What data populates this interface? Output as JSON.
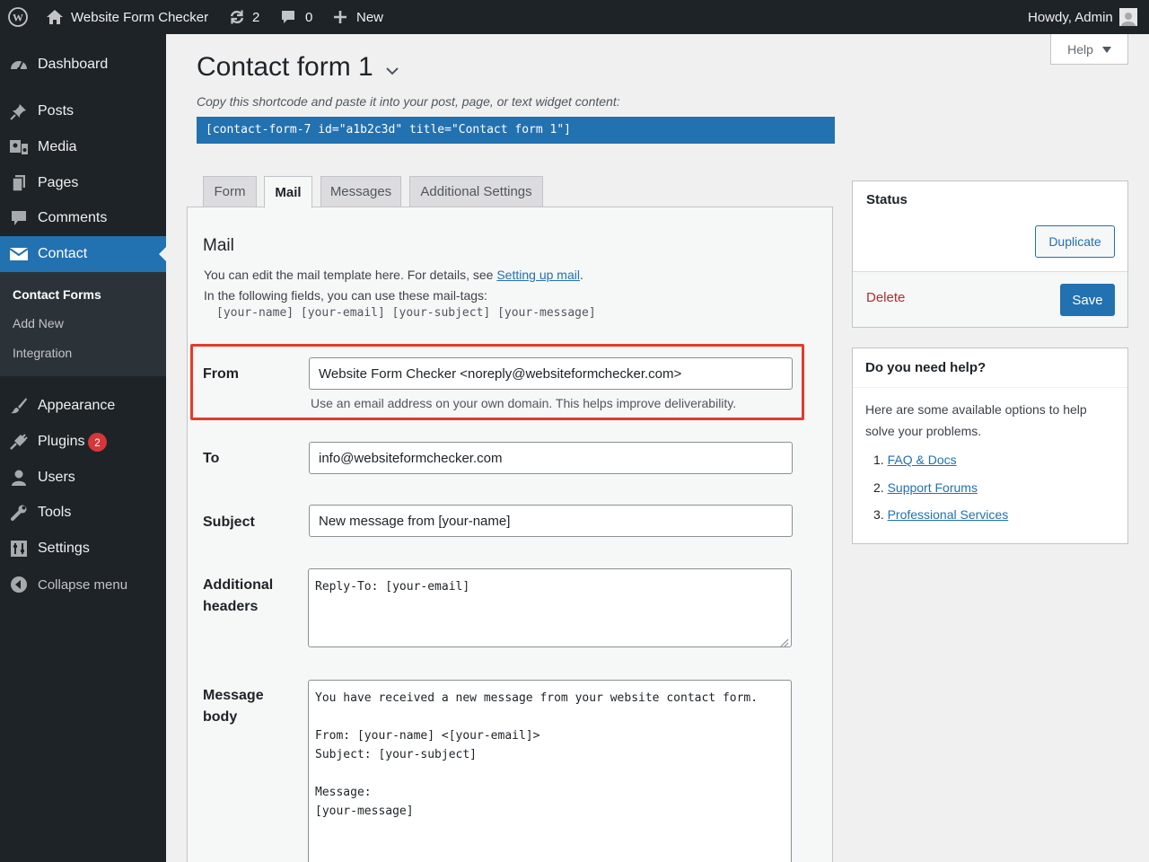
{
  "admin_bar": {
    "site_name": "Website Form Checker",
    "updates_count": "2",
    "comments_count": "0",
    "new_label": "New",
    "greeting": "Howdy, Admin"
  },
  "sidebar": {
    "items": [
      {
        "label": "Dashboard",
        "icon": "dashboard-icon"
      },
      {
        "label": "Posts",
        "icon": "pin-icon"
      },
      {
        "label": "Media",
        "icon": "media-icon"
      },
      {
        "label": "Pages",
        "icon": "pages-icon"
      },
      {
        "label": "Comments",
        "icon": "comment-icon"
      },
      {
        "label": "Contact",
        "icon": "envelope-icon"
      },
      {
        "label": "Appearance",
        "icon": "brush-icon"
      },
      {
        "label": "Plugins",
        "icon": "plug-icon",
        "badge": "2"
      },
      {
        "label": "Users",
        "icon": "user-icon"
      },
      {
        "label": "Tools",
        "icon": "wrench-icon"
      },
      {
        "label": "Settings",
        "icon": "settings-icon"
      },
      {
        "label": "Collapse menu",
        "icon": "collapse-icon"
      }
    ],
    "submenu": [
      "Contact Forms",
      "Add New",
      "Integration"
    ]
  },
  "help_tab": {
    "label": "Help"
  },
  "page": {
    "title": "Contact form 1",
    "shortcode_hint": "Copy this shortcode and paste it into your post, page, or text widget content:",
    "shortcode": "[contact-form-7 id=\"a1b2c3d\" title=\"Contact form 1\"]"
  },
  "tabs": [
    "Form",
    "Mail",
    "Messages",
    "Additional Settings"
  ],
  "mail": {
    "heading": "Mail",
    "desc_prefix": "You can edit the mail template here. For details, see ",
    "desc_link": "Setting up mail",
    "desc_suffix": ".",
    "tags_intro": "In the following fields, you can use these mail-tags:",
    "tags": "[your-name] [your-email] [your-subject] [your-message]",
    "fields": {
      "from": {
        "label": "From",
        "value": "Website Form Checker <noreply@websiteformchecker.com>",
        "help": "Use an email address on your own domain. This helps improve deliverability."
      },
      "to": {
        "label": "To",
        "value": "info@websiteformchecker.com"
      },
      "subject": {
        "label": "Subject",
        "value": "New message from [your-name]"
      },
      "additional_headers": {
        "label_line1": "Additional",
        "label_line2": "headers",
        "value": "Reply-To: [your-email]"
      },
      "message_body": {
        "label_line1": "Message",
        "label_line2": "body",
        "value": "You have received a new message from your website contact form.\n\nFrom: [your-name] <[your-email]>\nSubject: [your-subject]\n\nMessage:\n[your-message]"
      }
    }
  },
  "status_box": {
    "title": "Status",
    "duplicate_label": "Duplicate",
    "delete_label": "Delete",
    "save_label": "Save"
  },
  "help_box": {
    "title": "Do you need help?",
    "text_line1": "Here are some available options to help",
    "text_line2": "solve your problems.",
    "links": [
      {
        "num": "1.",
        "label": "FAQ & Docs"
      },
      {
        "num": "2.",
        "label": "Support Forums"
      },
      {
        "num": "3.",
        "label": "Professional Services"
      }
    ]
  },
  "colors": {
    "admin_dark": "#1d2327",
    "accent_blue": "#2271b1",
    "highlight_red": "#e53a2a",
    "delete_red": "#b32d2e",
    "badge_red": "#d63638"
  }
}
